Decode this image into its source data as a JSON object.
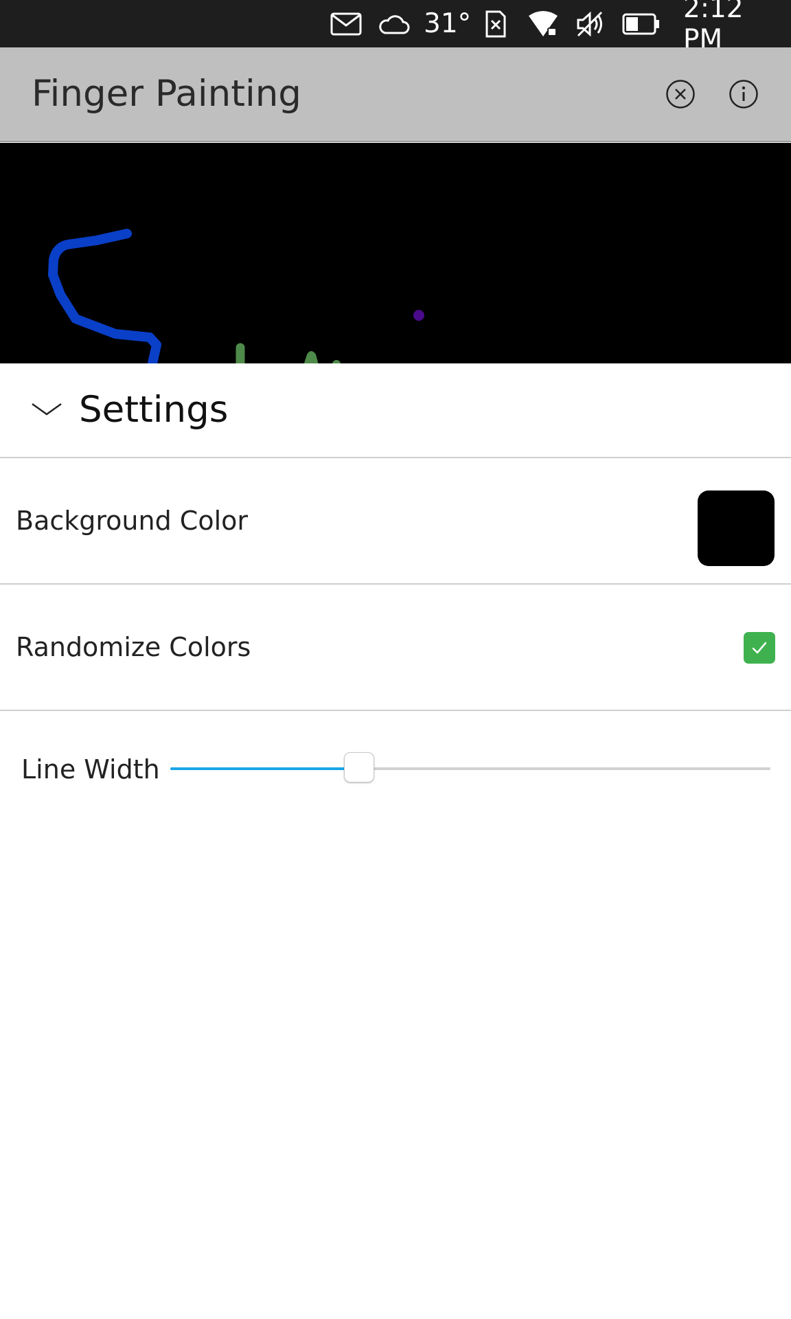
{
  "status_bar": {
    "temperature": "31°",
    "time": "2:12 PM",
    "icons": [
      "mail-icon",
      "cloud-icon",
      "sim-icon",
      "wifi-icon",
      "volume-muted-icon",
      "battery-icon"
    ],
    "battery_level": 0.45
  },
  "header": {
    "title": "Finger Painting",
    "buttons": [
      "clear-icon",
      "info-icon"
    ]
  },
  "canvas": {
    "background": "#000000",
    "stroke_colors": [
      "#0a3fc8",
      "#4e8a4a",
      "#4a0b8a"
    ]
  },
  "settings": {
    "title": "Settings",
    "background_color_label": "Background Color",
    "background_color_value": "#000000",
    "randomize_label": "Randomize Colors",
    "randomize_checked": true,
    "line_width_label": "Line Width",
    "line_width_fraction": 0.315
  },
  "colors": {
    "accent": "#19a6e8",
    "checkbox": "#3fb24f",
    "header_bg": "#bfbfbf",
    "status_bg": "#1e1e1e"
  }
}
